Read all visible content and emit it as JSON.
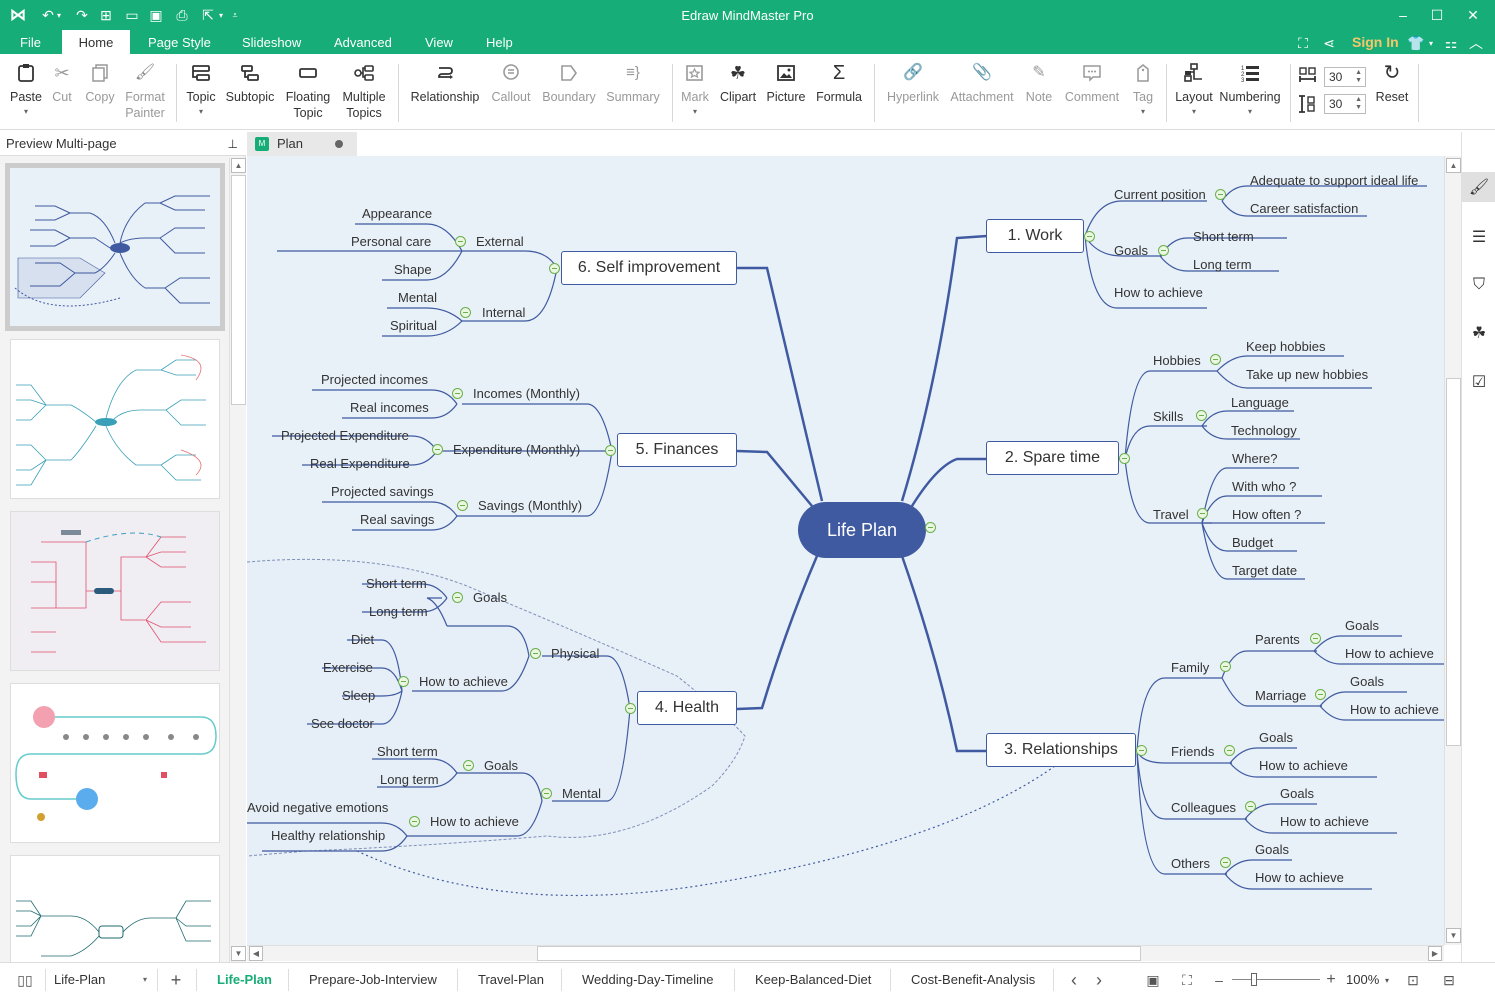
{
  "titlebar": {
    "app_title": "Edraw MindMaster Pro",
    "quick_access": [
      "logo-icon",
      "undo-icon",
      "redo-icon",
      "new-icon",
      "open-icon",
      "save-icon",
      "print-icon",
      "export-icon",
      "customize-icon"
    ]
  },
  "menu": {
    "tabs": [
      "File",
      "Home",
      "Page Style",
      "Slideshow",
      "Advanced",
      "View",
      "Help"
    ],
    "active": "Home",
    "sign_in": "Sign In"
  },
  "ribbon": {
    "paste": "Paste",
    "cut": "Cut",
    "copy": "Copy",
    "format_painter": "Format Painter",
    "topic": "Topic",
    "subtopic": "Subtopic",
    "floating_topic": "Floating Topic",
    "multiple_topics": "Multiple Topics",
    "relationship": "Relationship",
    "callout": "Callout",
    "boundary": "Boundary",
    "summary": "Summary",
    "mark": "Mark",
    "clipart": "Clipart",
    "picture": "Picture",
    "formula": "Formula",
    "hyperlink": "Hyperlink",
    "attachment": "Attachment",
    "note": "Note",
    "comment": "Comment",
    "tag": "Tag",
    "layout": "Layout",
    "numbering": "Numbering",
    "h_spacing": "30",
    "v_spacing": "30",
    "reset": "Reset"
  },
  "left_pane": {
    "title": "Preview Multi-page",
    "pages": [
      "Life-Plan",
      "Prepare-Job-Interview",
      "Travel-Plan",
      "Wedding-Day-Timeline",
      "Keep-Balanced-Diet"
    ],
    "selected": 0
  },
  "doc_tab": {
    "name": "Plan"
  },
  "mindmap": {
    "central": "Life Plan",
    "work": {
      "title": "1. Work",
      "current_position": "Current position",
      "adequate": "Adequate to support ideal life",
      "career": "Career satisfaction",
      "goals": "Goals",
      "short": "Short term",
      "long": "Long term",
      "how": "How to achieve"
    },
    "spare": {
      "title": "2. Spare time",
      "hobbies": "Hobbies",
      "keep": "Keep hobbies",
      "take": "Take up new hobbies",
      "skills": "Skills",
      "language": "Language",
      "technology": "Technology",
      "travel": "Travel",
      "where": "Where?",
      "with_who": "With who ?",
      "how_often": "How often ?",
      "budget": "Budget",
      "target": "Target date"
    },
    "rel": {
      "title": "3. Relationships",
      "family": "Family",
      "parents": "Parents",
      "marriage": "Marriage",
      "friends": "Friends",
      "colleagues": "Colleagues",
      "others": "Others",
      "goals": "Goals",
      "how": "How to achieve"
    },
    "health": {
      "title": "4. Health",
      "physical": "Physical",
      "goals": "Goals",
      "short": "Short term",
      "long": "Long term",
      "how": "How to achieve",
      "diet": "Diet",
      "exercise": "Exercise",
      "sleep": "Sleep",
      "doctor": "See doctor",
      "mental": "Mental",
      "avoid": "Avoid negative emotions",
      "healthy": "Healthy relationship"
    },
    "fin": {
      "title": "5. Finances",
      "incomes": "Incomes (Monthly)",
      "proj_inc": "Projected incomes",
      "real_inc": "Real incomes",
      "expend": "Expenditure (Monthly)",
      "proj_exp": "Projected Expenditure",
      "real_exp": "Real Expenditure",
      "savings": "Savings (Monthly)",
      "proj_sav": "Projected savings",
      "real_sav": "Real savings"
    },
    "self": {
      "title": "6. Self improvement",
      "external": "External",
      "appearance": "Appearance",
      "personal": "Personal care",
      "shape": "Shape",
      "internal": "Internal",
      "mental": "Mental",
      "spiritual": "Spiritual"
    }
  },
  "statusbar": {
    "page_select": "Life-Plan",
    "page_tabs": [
      "Life-Plan",
      "Prepare-Job-Interview",
      "Travel-Plan",
      "Wedding-Day-Timeline",
      "Keep-Balanced-Diet",
      "Cost-Benefit-Analysis"
    ],
    "active_tab": "Life-Plan",
    "zoom": "100%",
    "zoom_fraction": 0.25
  },
  "colors": {
    "brand": "#17ad78",
    "topic": "#3f5aa0",
    "collapse": "#6ab04c",
    "canvas": "#e8f0f8",
    "sign_in": "#f6c76a"
  }
}
